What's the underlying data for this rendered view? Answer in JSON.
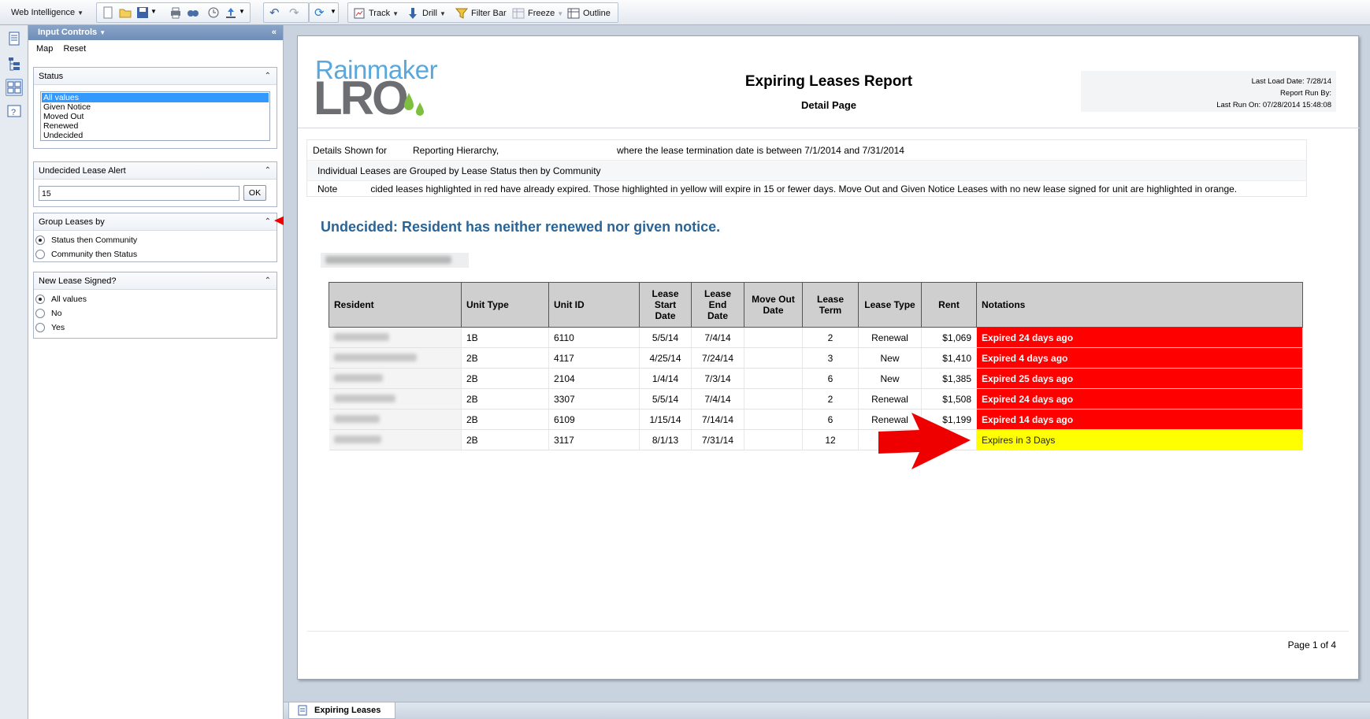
{
  "toolbar": {
    "app_menu": "Web Intelligence",
    "track": "Track",
    "drill": "Drill",
    "filter_bar": "Filter Bar",
    "freeze": "Freeze",
    "outline": "Outline"
  },
  "panel": {
    "title": "Input Controls",
    "map": "Map",
    "reset": "Reset",
    "status": {
      "title": "Status",
      "options": [
        "All values",
        "Given Notice",
        "Moved Out",
        "Renewed",
        "Undecided"
      ],
      "selected": "All values"
    },
    "alert": {
      "title": "Undecided Lease Alert",
      "value": "15",
      "ok": "OK"
    },
    "group": {
      "title": "Group Leases by",
      "options": [
        "Status then Community",
        "Community then Status"
      ],
      "selected": "Status then Community"
    },
    "new_lease": {
      "title": "New Lease Signed?",
      "options": [
        "All values",
        "No",
        "Yes"
      ],
      "selected": "All values"
    }
  },
  "report": {
    "logo_top": "Rainmaker",
    "logo_bottom": "LRO",
    "title": "Expiring Leases Report",
    "subtitle": "Detail Page",
    "last_load": "Last Load Date: 7/28/14",
    "run_by": "Report Run By:",
    "last_run": "Last Run On: 07/28/2014 15:48:08",
    "details_shown_for": "Details Shown for",
    "reporting_hierarchy": "Reporting Hierarchy,",
    "date_range": "where the lease termination date is between 7/1/2014  and 7/31/2014",
    "grouping_note": "Individual Leases are Grouped by Lease Status then by Community",
    "note_prefix": "Note",
    "note_rest": "cided leases highlighted in red have already expired. Those highlighted in yellow will expire in 15 or fewer days. Move Out and Given Notice Leases with no new lease signed for unit are highlighted in orange.",
    "section_heading": "Undecided: Resident has neither renewed nor given notice.",
    "page": "Page 1 of 4"
  },
  "table": {
    "headers": [
      "Resident",
      "Unit Type",
      "Unit ID",
      "Lease Start Date",
      "Lease End Date",
      "Move Out Date",
      "Lease Term",
      "Lease Type",
      "Rent",
      "Notations"
    ],
    "rows": [
      {
        "unit_type": "1B",
        "unit_id": "6110",
        "start": "5/5/14",
        "end": "7/4/14",
        "move_out": "",
        "term": "2",
        "type": "Renewal",
        "rent": "$1,069",
        "notation": "Expired 24 days ago",
        "level": "red"
      },
      {
        "unit_type": "2B",
        "unit_id": "4117",
        "start": "4/25/14",
        "end": "7/24/14",
        "move_out": "",
        "term": "3",
        "type": "New",
        "rent": "$1,410",
        "notation": "Expired 4 days ago",
        "level": "red"
      },
      {
        "unit_type": "2B",
        "unit_id": "2104",
        "start": "1/4/14",
        "end": "7/3/14",
        "move_out": "",
        "term": "6",
        "type": "New",
        "rent": "$1,385",
        "notation": "Expired 25 days ago",
        "level": "red"
      },
      {
        "unit_type": "2B",
        "unit_id": "3307",
        "start": "5/5/14",
        "end": "7/4/14",
        "move_out": "",
        "term": "2",
        "type": "Renewal",
        "rent": "$1,508",
        "notation": "Expired 24 days ago",
        "level": "red"
      },
      {
        "unit_type": "2B",
        "unit_id": "6109",
        "start": "1/15/14",
        "end": "7/14/14",
        "move_out": "",
        "term": "6",
        "type": "Renewal",
        "rent": "$1,199",
        "notation": "Expired 14 days ago",
        "level": "red"
      },
      {
        "unit_type": "2B",
        "unit_id": "3117",
        "start": "8/1/13",
        "end": "7/31/14",
        "move_out": "",
        "term": "12",
        "type": "",
        "rent": "",
        "notation": "Expires in 3 Days",
        "level": "yellow"
      }
    ]
  },
  "tabs": {
    "report_tab": "Expiring Leases"
  },
  "colors": {
    "expired": "#ff0000",
    "expiring": "#ffff00",
    "heading": "#2a6496",
    "arrow": "#ee0000"
  }
}
